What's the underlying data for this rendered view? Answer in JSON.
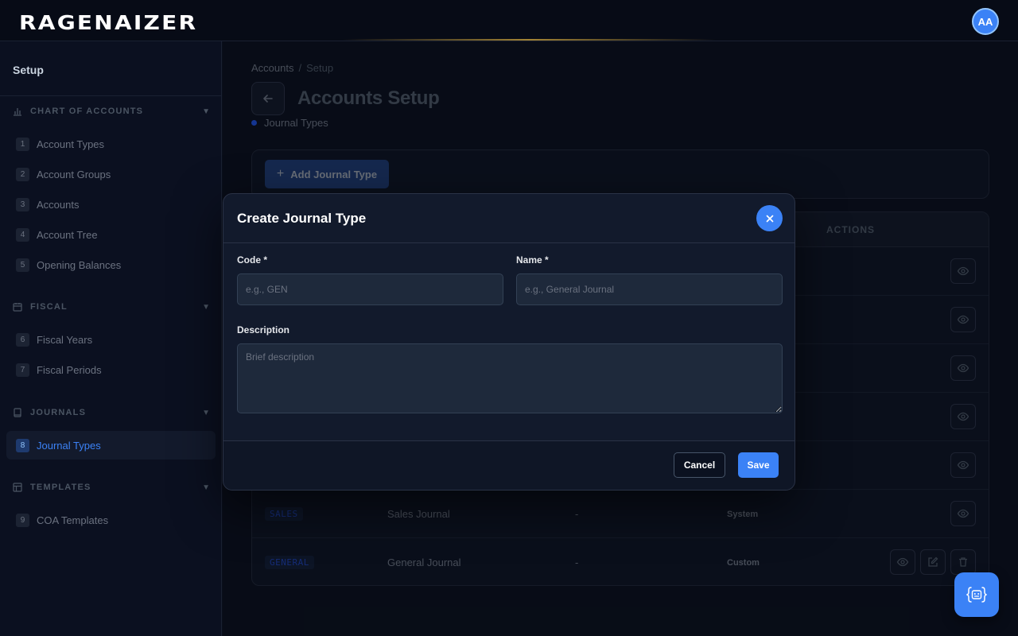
{
  "app": {
    "logo": "RAGENAIZER",
    "avatar_initials": "AA"
  },
  "sidebar": {
    "title": "Setup",
    "sections": [
      {
        "label": "CHART OF ACCOUNTS",
        "icon": "bar-chart-icon",
        "items": [
          {
            "num": "1",
            "label": "Account Types"
          },
          {
            "num": "2",
            "label": "Account Groups"
          },
          {
            "num": "3",
            "label": "Accounts"
          },
          {
            "num": "4",
            "label": "Account Tree"
          },
          {
            "num": "5",
            "label": "Opening Balances"
          }
        ]
      },
      {
        "label": "FISCAL",
        "icon": "calendar-icon",
        "items": [
          {
            "num": "6",
            "label": "Fiscal Years"
          },
          {
            "num": "7",
            "label": "Fiscal Periods"
          }
        ]
      },
      {
        "label": "JOURNALS",
        "icon": "book-icon",
        "items": [
          {
            "num": "8",
            "label": "Journal Types",
            "active": true
          }
        ]
      },
      {
        "label": "TEMPLATES",
        "icon": "grid-icon",
        "items": [
          {
            "num": "9",
            "label": "COA Templates"
          }
        ]
      }
    ]
  },
  "breadcrumb": {
    "root": "Accounts",
    "separator": "/",
    "current": "Setup"
  },
  "page": {
    "title": "Accounts Setup",
    "subtitle": "Journal Types"
  },
  "toolbar": {
    "add_label": "Add Journal Type"
  },
  "table": {
    "actions_header": "ACTIONS",
    "rows": [
      {
        "code": "SALES",
        "name": "Sales Journal",
        "description": "-",
        "type": "System"
      },
      {
        "code": "GENERAL",
        "name": "General Journal",
        "description": "-",
        "type": "Custom"
      }
    ]
  },
  "modal": {
    "title": "Create Journal Type",
    "code_label": "Code *",
    "code_placeholder": "e.g., GEN",
    "name_label": "Name *",
    "name_placeholder": "e.g., General Journal",
    "description_label": "Description",
    "description_placeholder": "Brief description",
    "cancel_label": "Cancel",
    "save_label": "Save"
  },
  "colors": {
    "accent": "#3b82f6",
    "background": "#0a0f1c",
    "sidebar": "#0b1020"
  }
}
